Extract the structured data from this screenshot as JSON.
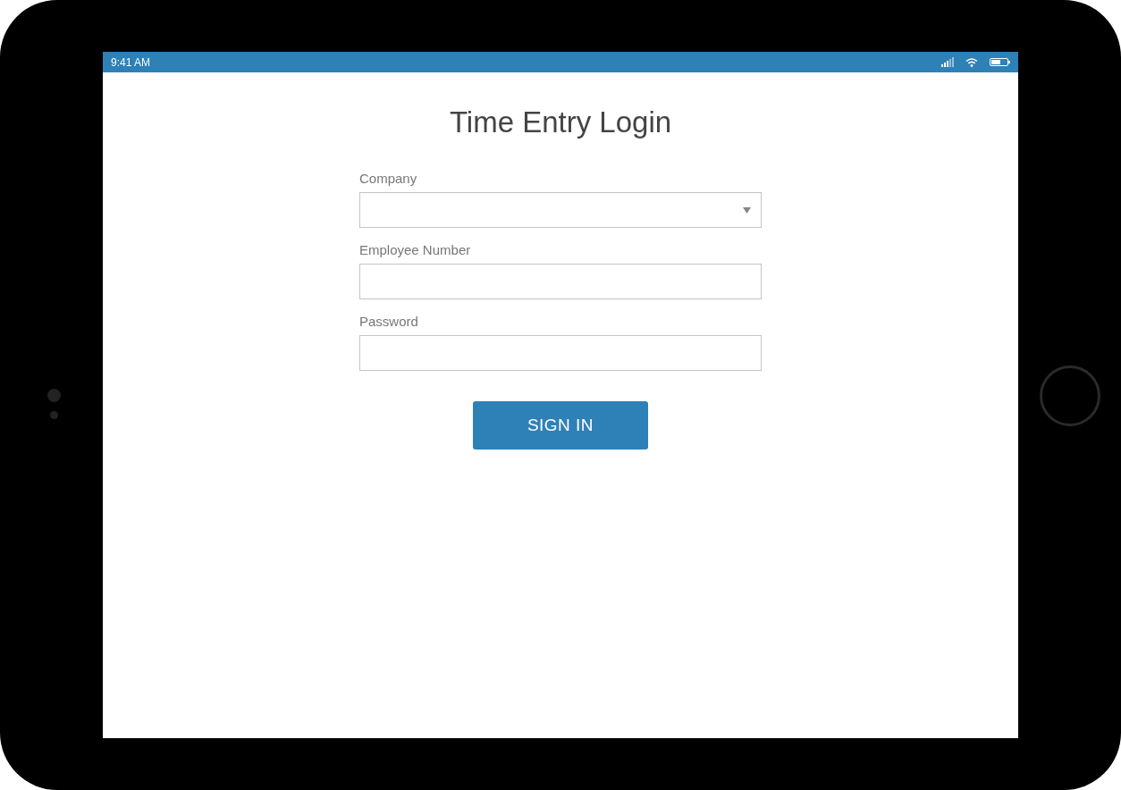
{
  "status_bar": {
    "time": "9:41 AM"
  },
  "title": "Time Entry Login",
  "fields": [
    {
      "label": "Company",
      "kind": "select"
    },
    {
      "label": "Employee Number",
      "kind": "text"
    },
    {
      "label": "Password",
      "kind": "password"
    }
  ],
  "button": "SIGN IN"
}
